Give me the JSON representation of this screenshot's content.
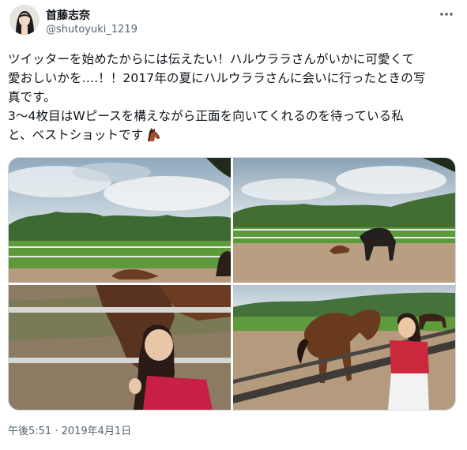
{
  "author": {
    "display_name": "首藤志奈",
    "handle": "@shutoyuki_1219"
  },
  "tweet": {
    "lines": [
      "ツイッターを始めたからには伝えたい！ハルウララさんがいかに可愛くて",
      "愛おしいかを….！！2017年の夏にハルウララさんに会いに行ったときの写",
      "真です。",
      "3〜4枚目はWピースを構えながら正面を向いてくれるのを待っている私",
      "と、ベストショットです"
    ],
    "emoji": "horse-face-icon"
  },
  "media": {
    "photo_count": 4,
    "photos": [
      "horses-paddock-wide-1",
      "horses-paddock-wide-2",
      "girl-with-horses-fence-1",
      "girl-with-horse-fence-2"
    ]
  },
  "timestamp": "午後5:51 · 2019年4月1日",
  "icons": {
    "more": "more-dots-icon",
    "avatar": "avatar"
  }
}
